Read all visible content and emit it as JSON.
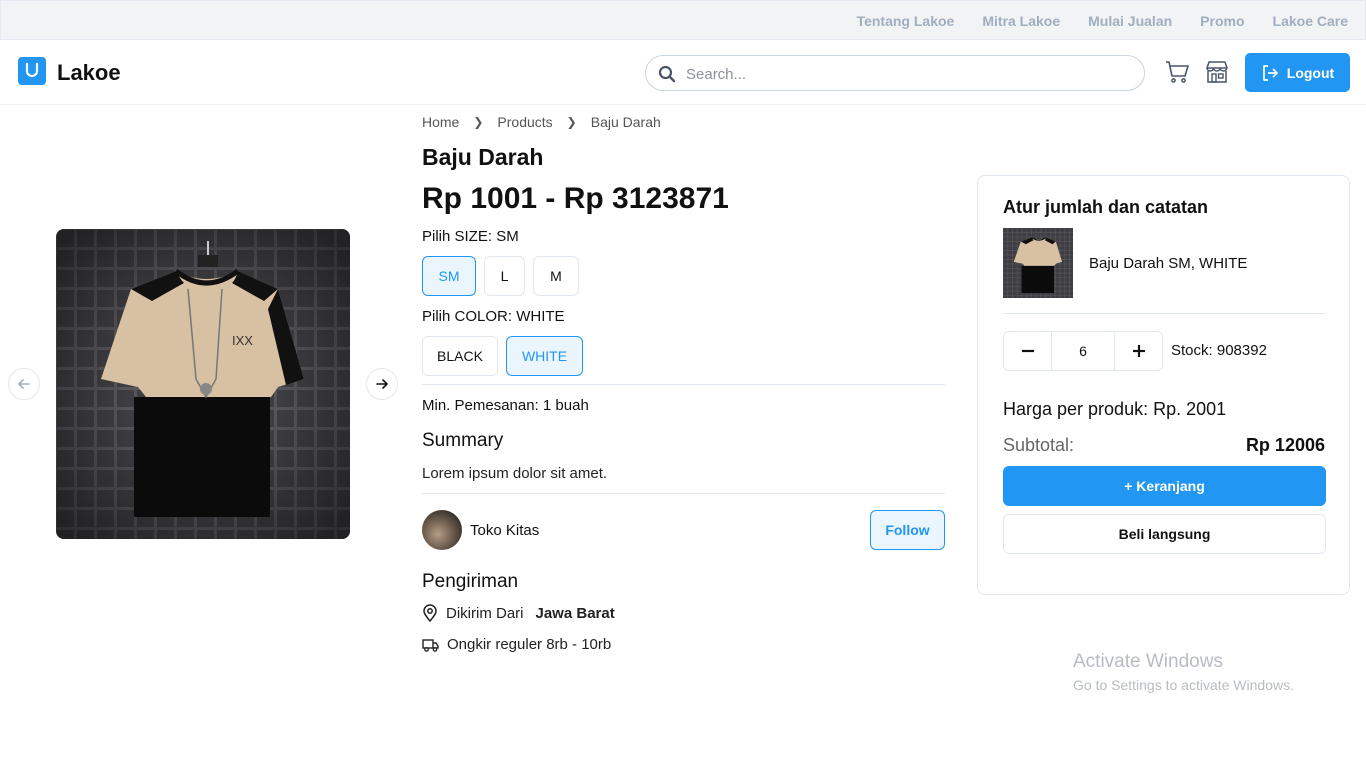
{
  "topbar": {
    "links": [
      "Tentang Lakoe",
      "Mitra Lakoe",
      "Mulai Jualan",
      "Promo",
      "Lakoe Care"
    ]
  },
  "header": {
    "brand": "Lakoe",
    "search_placeholder": "Search...",
    "logout_label": "Logout",
    "brand_color": "#2196f3"
  },
  "breadcrumb": [
    "Home",
    "Products",
    "Baju Darah"
  ],
  "product": {
    "name": "Baju Darah",
    "price_range": "Rp 1001 - Rp 3123871",
    "size_label": "Pilih SIZE:",
    "size_selected": "SM",
    "sizes": [
      "SM",
      "L",
      "M"
    ],
    "color_label": "Pilih COLOR:",
    "color_selected": "WHITE",
    "colors": [
      "BLACK",
      "WHITE"
    ],
    "min_order_label": "Min. Pemesanan:",
    "min_order_value": "1 buah",
    "summary_heading": "Summary",
    "summary_text": "Lorem ipsum dolor sit amet."
  },
  "shop": {
    "name": "Toko Kitas",
    "follow_label": "Follow"
  },
  "shipping": {
    "heading": "Pengiriman",
    "from_label": "Dikirim Dari",
    "from_value": "Jawa Barat",
    "cost_text": "Ongkir reguler 8rb - 10rb"
  },
  "order_card": {
    "title": "Atur jumlah dan catatan",
    "variant_label": "Baju Darah SM, WHITE",
    "quantity": "6",
    "stock_label": "Stock:",
    "stock_value": "908392",
    "price_per_product": "Harga per produk: Rp. 2001",
    "subtotal_label": "Subtotal:",
    "subtotal_value": "Rp 12006",
    "add_cart_label": "+ Keranjang",
    "buy_now_label": "Beli langsung"
  },
  "watermark": {
    "line1": "Activate Windows",
    "line2": "Go to Settings to activate Windows."
  }
}
